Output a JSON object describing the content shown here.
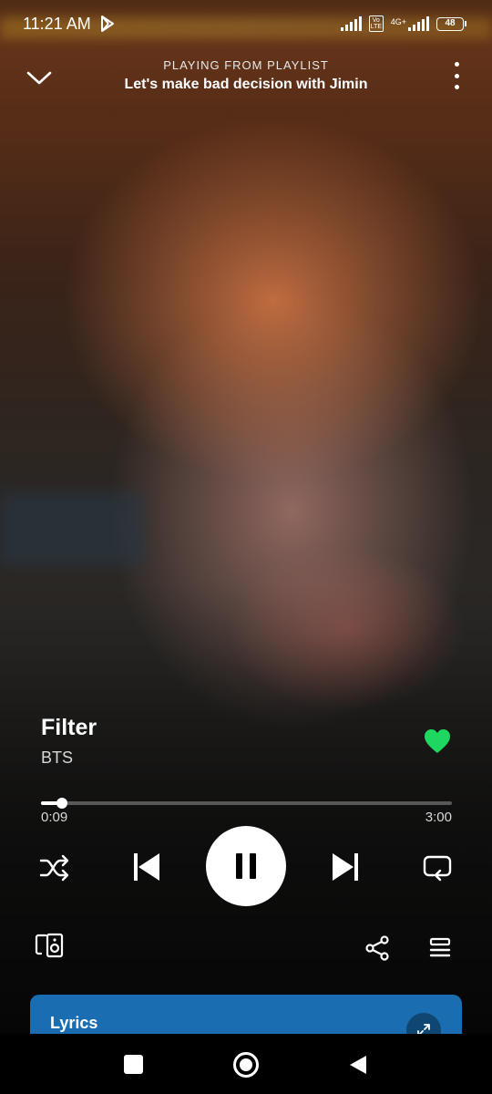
{
  "status_bar": {
    "time": "11:21 AM",
    "volte": "Vo LTE",
    "network": "4G+",
    "battery": "48"
  },
  "header": {
    "context_label": "PLAYING FROM PLAYLIST",
    "playlist_name": "Let's make bad decision with Jimin"
  },
  "track": {
    "title": "Filter",
    "artist": "BTS",
    "liked": true
  },
  "progress": {
    "elapsed": "0:09",
    "total": "3:00",
    "fraction": 0.05
  },
  "controls": {
    "shuffle_icon": "shuffle-icon",
    "previous_icon": "skip-previous-icon",
    "play_state": "playing",
    "next_icon": "skip-next-icon",
    "repeat_icon": "repeat-icon"
  },
  "bottom_actions": {
    "devices_icon": "connect-devices-icon",
    "share_icon": "share-icon",
    "queue_icon": "queue-icon"
  },
  "lyrics": {
    "label": "Lyrics"
  },
  "colors": {
    "accent_green": "#1ed760",
    "lyrics_card": "#1a6db0"
  }
}
